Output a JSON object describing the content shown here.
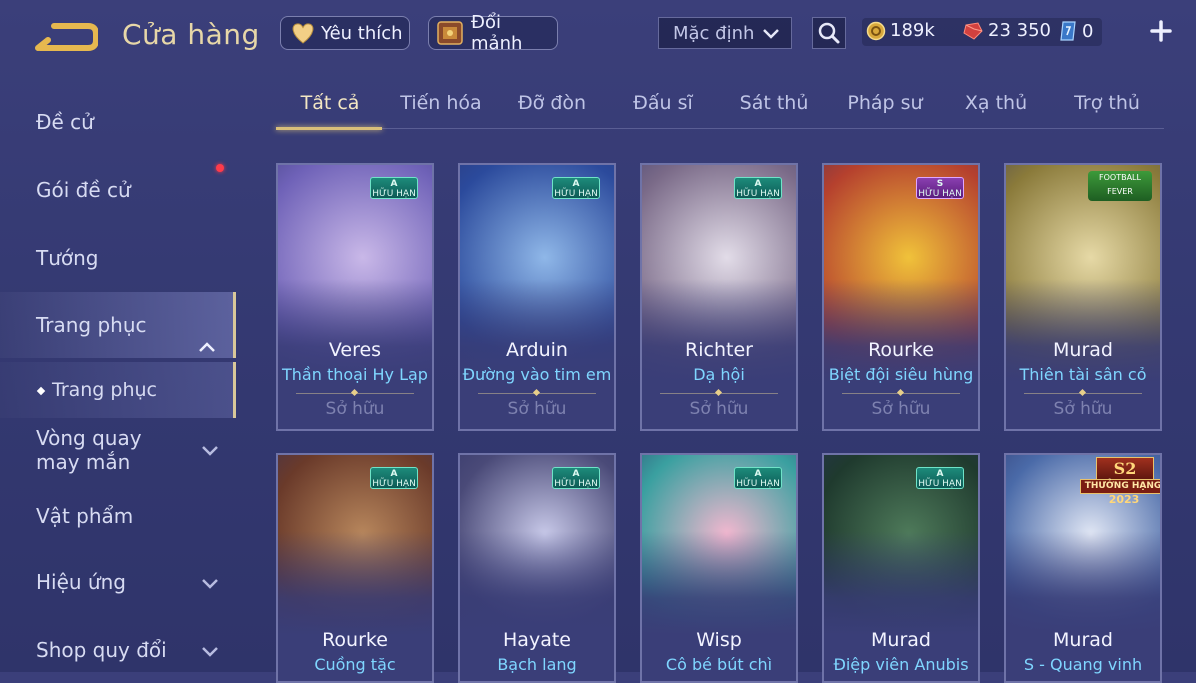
{
  "header": {
    "title": "Cửa hàng",
    "favorite_label": "Yêu thích",
    "exchange_label": "Đổi mảnh",
    "sort_value": "Mặc định",
    "currencies": {
      "gold": "189k",
      "ruby": "23 350",
      "voucher": "0"
    }
  },
  "sidebar": {
    "items": [
      {
        "label": "Đề cử"
      },
      {
        "label": "Gói đề cử"
      },
      {
        "label": "Tướng"
      },
      {
        "label": "Trang phục"
      },
      {
        "label": "Trang phục"
      },
      {
        "label": "Vòng quay may mắn"
      },
      {
        "label": "Vật phẩm"
      },
      {
        "label": "Hiệu ứng"
      },
      {
        "label": "Shop quy đổi"
      }
    ]
  },
  "tabs": [
    "Tất cả",
    "Tiến hóa",
    "Đỡ đòn",
    "Đấu sĩ",
    "Sát thủ",
    "Pháp sư",
    "Xạ thủ",
    "Trợ thủ"
  ],
  "owned_label": "Sở hữu",
  "badge_limited": "HỮU HẠN",
  "cards": [
    {
      "hero": "Veres",
      "skin": "Thần thoại Hy Lạp",
      "rank": "A",
      "colors": [
        "#6f62b8",
        "#c9b8e8"
      ]
    },
    {
      "hero": "Arduin",
      "skin": "Đường vào tim em",
      "rank": "A",
      "colors": [
        "#2b4a9c",
        "#8fb7e8"
      ]
    },
    {
      "hero": "Richter",
      "skin": "Dạ hội",
      "rank": "A",
      "colors": [
        "#7a6a88",
        "#e2dce8"
      ]
    },
    {
      "hero": "Rourke",
      "skin": "Biệt đội siêu hùng",
      "rank": "S",
      "colors": [
        "#b5402e",
        "#f0c23a"
      ]
    },
    {
      "hero": "Murad",
      "skin": "Thiên tài sân cỏ",
      "rank": "",
      "colors": [
        "#8a7a3a",
        "#e6d9a6"
      ]
    },
    {
      "hero": "Rourke",
      "skin": "Cuồng tặc",
      "rank": "A",
      "colors": [
        "#6a3a2a",
        "#b7865c"
      ]
    },
    {
      "hero": "Hayate",
      "skin": "Bạch lang",
      "rank": "A",
      "colors": [
        "#4a4a78",
        "#c7c8e8"
      ]
    },
    {
      "hero": "Wisp",
      "skin": "Cô bé bút chì",
      "rank": "A",
      "colors": [
        "#3aa0a0",
        "#f2b7cf"
      ]
    },
    {
      "hero": "Murad",
      "skin": "Điệp viên Anubis",
      "rank": "A",
      "colors": [
        "#1f3a2e",
        "#4e7a5a"
      ]
    },
    {
      "hero": "Murad",
      "skin": "S - Quang vinh",
      "rank": "",
      "colors": [
        "#4a6aa8",
        "#e0e6f4"
      ]
    }
  ],
  "event_tag": "FOOTBALL FEVER",
  "season_tag": {
    "line1": "S2",
    "line2": "THƯỞNG HẠNG",
    "line3": "2023"
  },
  "accent_colors": {
    "gold": "#d9bf7a",
    "skin_text": "#7fd6ff",
    "limited_badge": "#1d8b7b"
  }
}
